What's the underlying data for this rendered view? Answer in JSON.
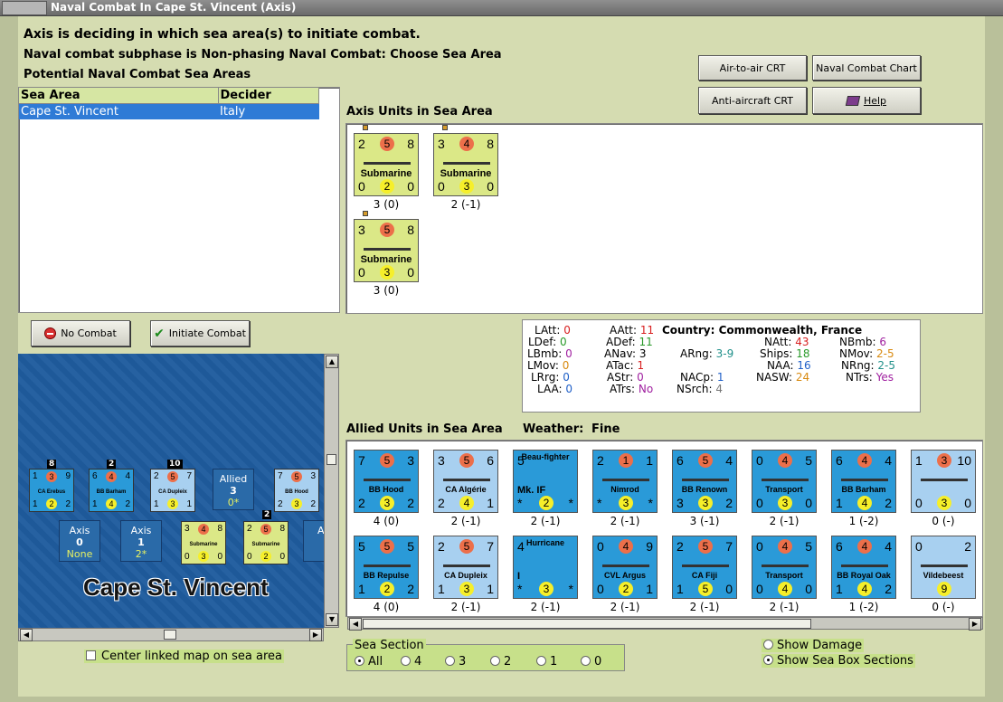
{
  "window": {
    "title": "Naval Combat In Cape St. Vincent (Axis)"
  },
  "header": {
    "deciding": "Axis is deciding in which sea area(s) to initiate combat.",
    "subphase": "Naval combat subphase is Non-phasing Naval Combat: Choose Sea Area",
    "potential": "Potential Naval Combat Sea Areas"
  },
  "sea_table": {
    "columns": [
      "Sea Area",
      "Decider"
    ],
    "rows": [
      [
        "Cape St. Vincent",
        "Italy"
      ]
    ]
  },
  "buttons": {
    "air_to_air": "Air-to-air CRT",
    "naval_chart": "Naval Combat Chart",
    "anti_aircraft": "Anti-aircraft CRT",
    "help": "Help",
    "no_combat": "No Combat",
    "initiate": "Initiate Combat"
  },
  "axis_units": {
    "label": "Axis Units in Sea Area",
    "units": [
      {
        "name": "Submarine",
        "tl": "2",
        "c": "5",
        "tr": "8",
        "bl": "0",
        "b": "2",
        "br": "0",
        "caption": "3 (0)"
      },
      {
        "name": "Submarine",
        "tl": "3",
        "c": "4",
        "tr": "8",
        "bl": "0",
        "b": "3",
        "br": "0",
        "caption": "2 (-1)"
      },
      {
        "name": "Submarine",
        "tl": "3",
        "c": "5",
        "tr": "8",
        "bl": "0",
        "b": "3",
        "br": "0",
        "caption": "3 (0)"
      }
    ]
  },
  "stats": {
    "latt": {
      "label": "LAtt:",
      "value": "0"
    },
    "ldef": {
      "label": "LDef:",
      "value": "0"
    },
    "lbmb": {
      "label": "LBmb:",
      "value": "0"
    },
    "lmov": {
      "label": "LMov:",
      "value": "0"
    },
    "lrrg": {
      "label": "LRrg:",
      "value": "0"
    },
    "laa": {
      "label": "LAA:",
      "value": "0"
    },
    "aatt": {
      "label": "AAtt:",
      "value": "11"
    },
    "adef": {
      "label": "ADef:",
      "value": "11"
    },
    "anav": {
      "label": "ANav:",
      "value": "3"
    },
    "atac": {
      "label": "ATac:",
      "value": "1"
    },
    "astr": {
      "label": "AStr:",
      "value": "0"
    },
    "atrs": {
      "label": "ATrs:",
      "value": "No"
    },
    "country": "Country:  Commonwealth, France",
    "arng": {
      "label": "ARng:",
      "value": "3-9"
    },
    "nacp": {
      "label": "NACp:",
      "value": "1"
    },
    "nsrch": {
      "label": "NSrch:",
      "value": "4"
    },
    "natt": {
      "label": "NAtt:",
      "value": "43"
    },
    "ships": {
      "label": "Ships:",
      "value": "18"
    },
    "naa": {
      "label": "NAA:",
      "value": "16"
    },
    "nasw": {
      "label": "NASW:",
      "value": "24"
    },
    "nbmb": {
      "label": "NBmb:",
      "value": "6"
    },
    "nmov": {
      "label": "NMov:",
      "value": "2-5"
    },
    "nrng": {
      "label": "NRng:",
      "value": "2-5"
    },
    "ntrs": {
      "label": "NTrs:",
      "value": "Yes"
    }
  },
  "allied": {
    "label": "Allied Units in Sea Area",
    "weather_label": "Weather:",
    "weather": "Fine",
    "row1": [
      {
        "name": "BB Hood",
        "tl": "7",
        "c": "5",
        "tr": "3",
        "bl": "2",
        "b": "3",
        "br": "2",
        "caption": "4 (0)"
      },
      {
        "name": "CA Algérie",
        "tl": "3",
        "c": "5",
        "tr": "6",
        "bl": "2",
        "b": "4",
        "br": "1",
        "caption": "2 (-1)"
      },
      {
        "name": "Beau-fighter",
        "sub": "Mk. IF",
        "tl": "5",
        "bl": "*",
        "b": "2",
        "br": "*",
        "caption": "2 (-1)"
      },
      {
        "name": "Nimrod",
        "tl": "2",
        "c": "1",
        "tr": "1",
        "bl": "*",
        "b": "3",
        "br": "*",
        "caption": "2 (-1)"
      },
      {
        "name": "BB Renown",
        "tl": "6",
        "c": "5",
        "tr": "4",
        "bl": "3",
        "b": "3",
        "br": "2",
        "caption": "3 (-1)"
      },
      {
        "name": "Transport",
        "tl": "0",
        "c": "4",
        "tr": "5",
        "bl": "0",
        "b": "3",
        "br": "0",
        "caption": "2 (-1)"
      },
      {
        "name": "BB Barham",
        "tl": "6",
        "c": "4",
        "tr": "4",
        "bl": "1",
        "b": "4",
        "br": "2",
        "caption": "1 (-2)"
      },
      {
        "name": "",
        "tl": "1",
        "c": "3",
        "tr": "10",
        "bl": "0",
        "b": "3",
        "br": "0",
        "caption": "0 (-)"
      }
    ],
    "row2": [
      {
        "name": "BB Repulse",
        "tl": "5",
        "c": "5",
        "tr": "5",
        "bl": "1",
        "b": "2",
        "br": "2",
        "caption": "4 (0)"
      },
      {
        "name": "CA Dupleix",
        "tl": "2",
        "c": "5",
        "tr": "7",
        "bl": "1",
        "b": "3",
        "br": "1",
        "caption": "2 (-1)"
      },
      {
        "name": "Hurricane",
        "sub": "I",
        "tl": "4",
        "bl": "*",
        "b": "3",
        "br": "*",
        "caption": "2 (-1)"
      },
      {
        "name": "CVL Argus",
        "tl": "0",
        "c": "4",
        "tr": "9",
        "bl": "0",
        "b": "2",
        "br": "1",
        "caption": "2 (-1)"
      },
      {
        "name": "CA Fiji",
        "tl": "2",
        "c": "5",
        "tr": "7",
        "bl": "1",
        "b": "5",
        "br": "0",
        "caption": "2 (-1)"
      },
      {
        "name": "Transport",
        "tl": "0",
        "c": "4",
        "tr": "5",
        "bl": "0",
        "b": "4",
        "br": "0",
        "caption": "2 (-1)"
      },
      {
        "name": "BB Royal Oak",
        "tl": "6",
        "c": "4",
        "tr": "4",
        "bl": "1",
        "b": "4",
        "br": "2",
        "caption": "1 (-2)"
      },
      {
        "name": "Vildebeest",
        "tl": "0",
        "tr": "2",
        "b": "9",
        "caption": "0 (-)"
      }
    ]
  },
  "map": {
    "name": "Cape St. Vincent",
    "allied_box": {
      "label": "Allied",
      "value": "3",
      "sub": "0*"
    },
    "axis_boxes": [
      {
        "label": "Axis",
        "value": "0",
        "sub": "None"
      },
      {
        "label": "Axis",
        "value": "1",
        "sub": "2*"
      },
      {
        "label": "Ax",
        "value": "",
        "sub": ""
      }
    ],
    "stacks": [
      "8",
      "2",
      "10",
      "2"
    ],
    "counters": [
      {
        "name": "CA Erebus",
        "tl": "1",
        "c": "3",
        "tr": "9",
        "bl": "1",
        "b": "2",
        "br": "2"
      },
      {
        "name": "BB Barham",
        "tl": "6",
        "c": "4",
        "tr": "4",
        "bl": "1",
        "b": "4",
        "br": "2"
      },
      {
        "name": "CA Dupleix",
        "tl": "2",
        "c": "5",
        "tr": "7",
        "bl": "1",
        "b": "3",
        "br": "1"
      },
      {
        "name": "BB Hood",
        "tl": "7",
        "c": "5",
        "tr": "3",
        "bl": "2",
        "b": "3",
        "br": "2"
      },
      {
        "name": "Submarine",
        "tl": "3",
        "c": "4",
        "tr": "8",
        "bl": "0",
        "b": "3",
        "br": "0"
      },
      {
        "name": "Submarine",
        "tl": "2",
        "c": "5",
        "tr": "8",
        "bl": "0",
        "b": "2",
        "br": "0"
      }
    ]
  },
  "center_map": "Center linked map on sea area",
  "sea_section": {
    "label": "Sea Section",
    "options": [
      "All",
      "4",
      "3",
      "2",
      "1",
      "0"
    ],
    "selected": "All"
  },
  "display": {
    "show_damage": "Show Damage",
    "show_sections": "Show Sea Box Sections",
    "selected": "Show Sea Box Sections"
  },
  "colors": {
    "axis_counter": "#dbe887",
    "allied_counter": "#2a9ad8",
    "attack": "#ec6f4a",
    "defense": "#f6ef2a",
    "background": "#d5dcb1"
  }
}
